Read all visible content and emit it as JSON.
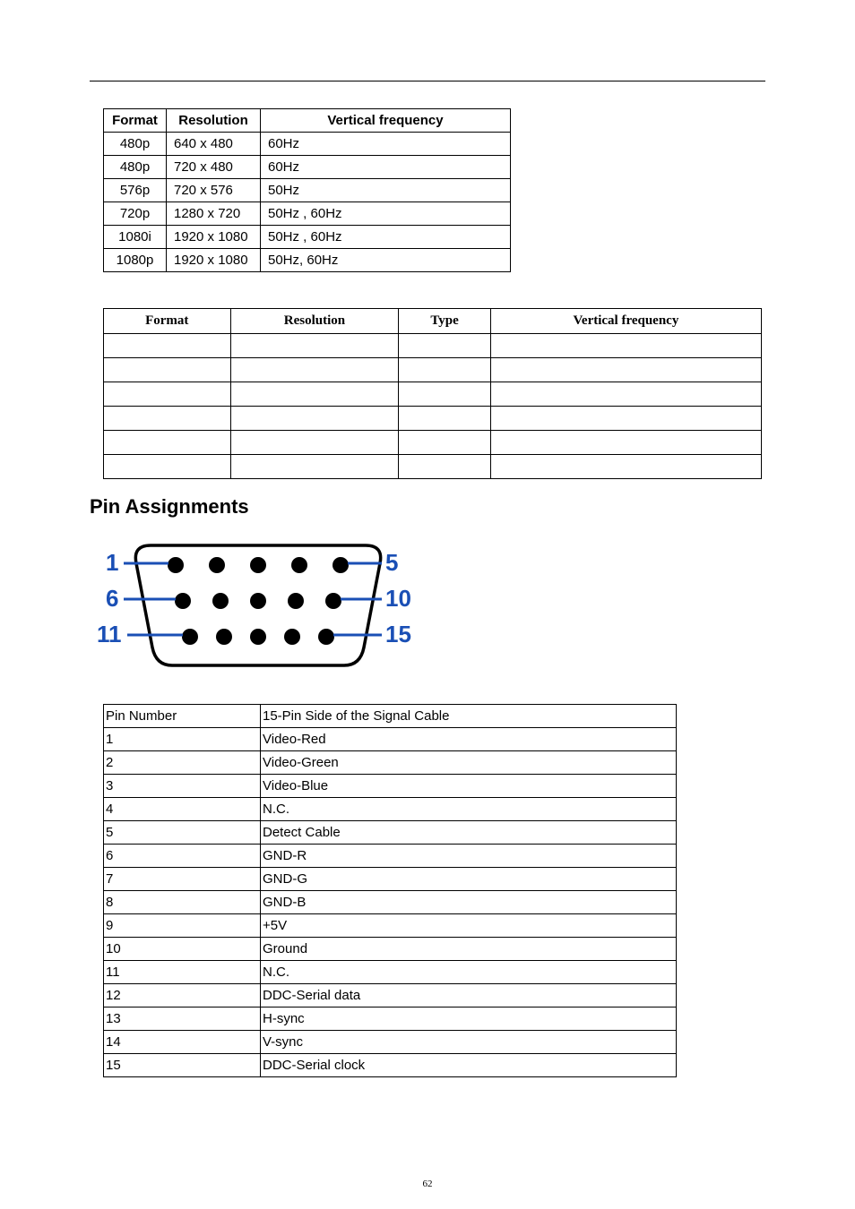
{
  "table1": {
    "headers": [
      "Format",
      "Resolution",
      "Vertical frequency"
    ],
    "rows": [
      [
        "480p",
        "640 x 480",
        "60Hz"
      ],
      [
        "480p",
        "720 x 480",
        "60Hz"
      ],
      [
        "576p",
        "720 x 576",
        "50Hz"
      ],
      [
        "720p",
        "1280 x 720",
        "50Hz , 60Hz"
      ],
      [
        "1080i",
        "1920 x 1080",
        "50Hz , 60Hz"
      ],
      [
        "1080p",
        "1920 x 1080",
        "50Hz, 60Hz"
      ]
    ]
  },
  "table2": {
    "headers": [
      "Format",
      "Resolution",
      "Type",
      "Vertical frequency"
    ]
  },
  "heading": "Pin Assignments",
  "connector": {
    "left": [
      "1",
      "6",
      "11"
    ],
    "right": [
      "5",
      "10",
      "15"
    ]
  },
  "table3": {
    "headers": [
      "Pin Number",
      "15-Pin Side of the Signal Cable"
    ],
    "rows": [
      [
        "1",
        "Video-Red"
      ],
      [
        "2",
        "Video-Green"
      ],
      [
        "3",
        "Video-Blue"
      ],
      [
        "4",
        "N.C."
      ],
      [
        "5",
        "Detect Cable"
      ],
      [
        "6",
        "GND-R"
      ],
      [
        "7",
        "GND-G"
      ],
      [
        "8",
        "GND-B"
      ],
      [
        "9",
        "+5V"
      ],
      [
        "10",
        "Ground"
      ],
      [
        "11",
        "N.C."
      ],
      [
        "12",
        "DDC-Serial data"
      ],
      [
        "13",
        "H-sync"
      ],
      [
        "14",
        "V-sync"
      ],
      [
        "15",
        "DDC-Serial clock"
      ]
    ]
  },
  "pageNumber": "62"
}
